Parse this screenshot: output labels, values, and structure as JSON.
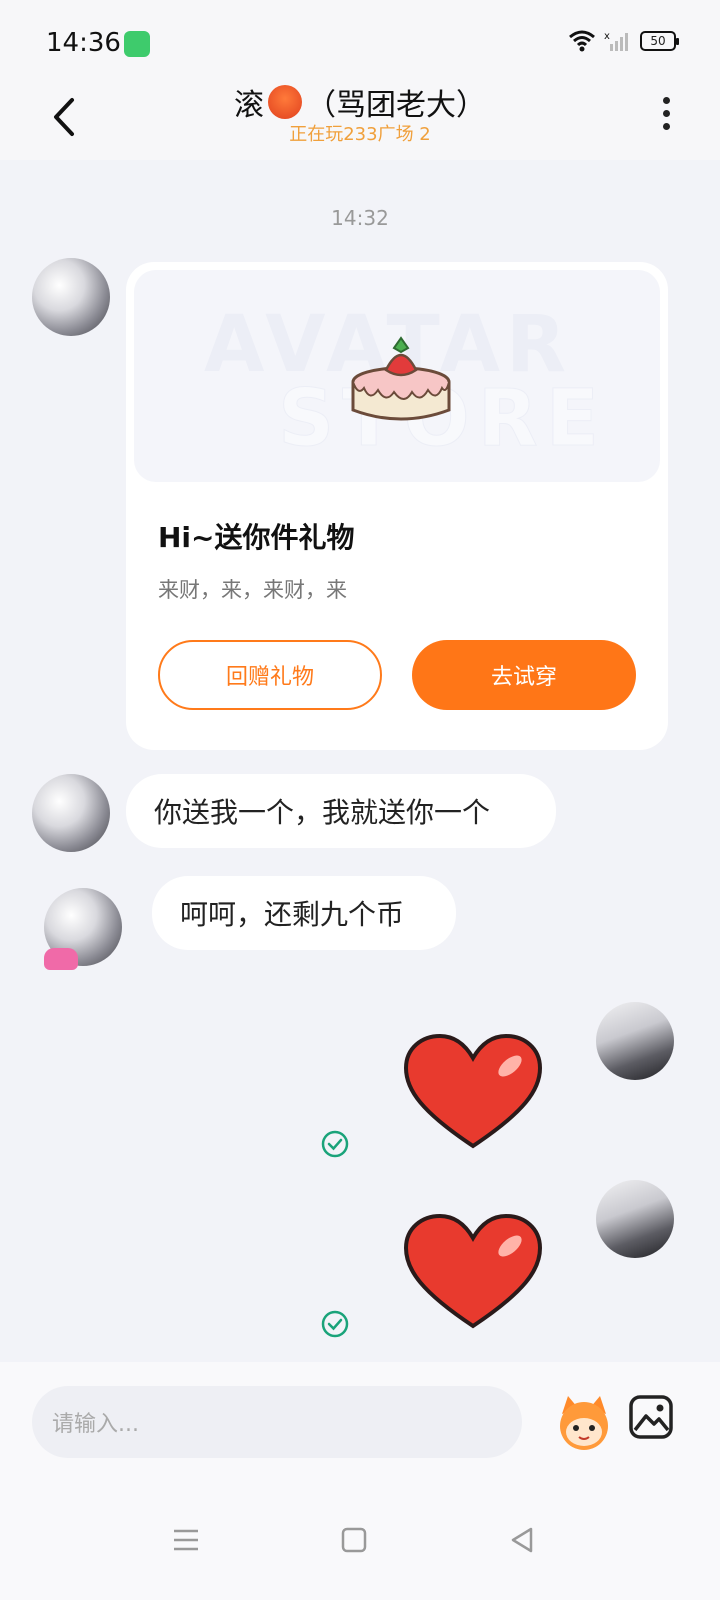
{
  "status_bar": {
    "time": "14:36",
    "battery": "50"
  },
  "header": {
    "title_prefix": "滚",
    "title_suffix": "（骂团老大）",
    "subtitle": "正在玩233广场 2"
  },
  "chat": {
    "time_label": "14:32",
    "gift_card": {
      "watermark_line1": "AVATAR",
      "watermark_line2": "STORE",
      "title": "Hi~送你件礼物",
      "description": "来财，来，来财，来",
      "return_gift_label": "回赠礼物",
      "try_on_label": "去试穿"
    },
    "messages": [
      {
        "sender": "other",
        "text": "你送我一个，我就送你一个"
      },
      {
        "sender": "other",
        "text": "呵呵，还剩九个币"
      }
    ]
  },
  "input": {
    "placeholder": "请输入..."
  },
  "colors": {
    "accent": "#ff7617",
    "subtitle": "#f0a03c",
    "check": "#1aa37a"
  },
  "icons": [
    "back-arrow-icon",
    "more-dots-icon",
    "cake-icon",
    "heart-sticker-icon",
    "check-icon",
    "mascot-icon",
    "image-icon",
    "menu-icon",
    "home-icon",
    "back-triangle-icon"
  ]
}
